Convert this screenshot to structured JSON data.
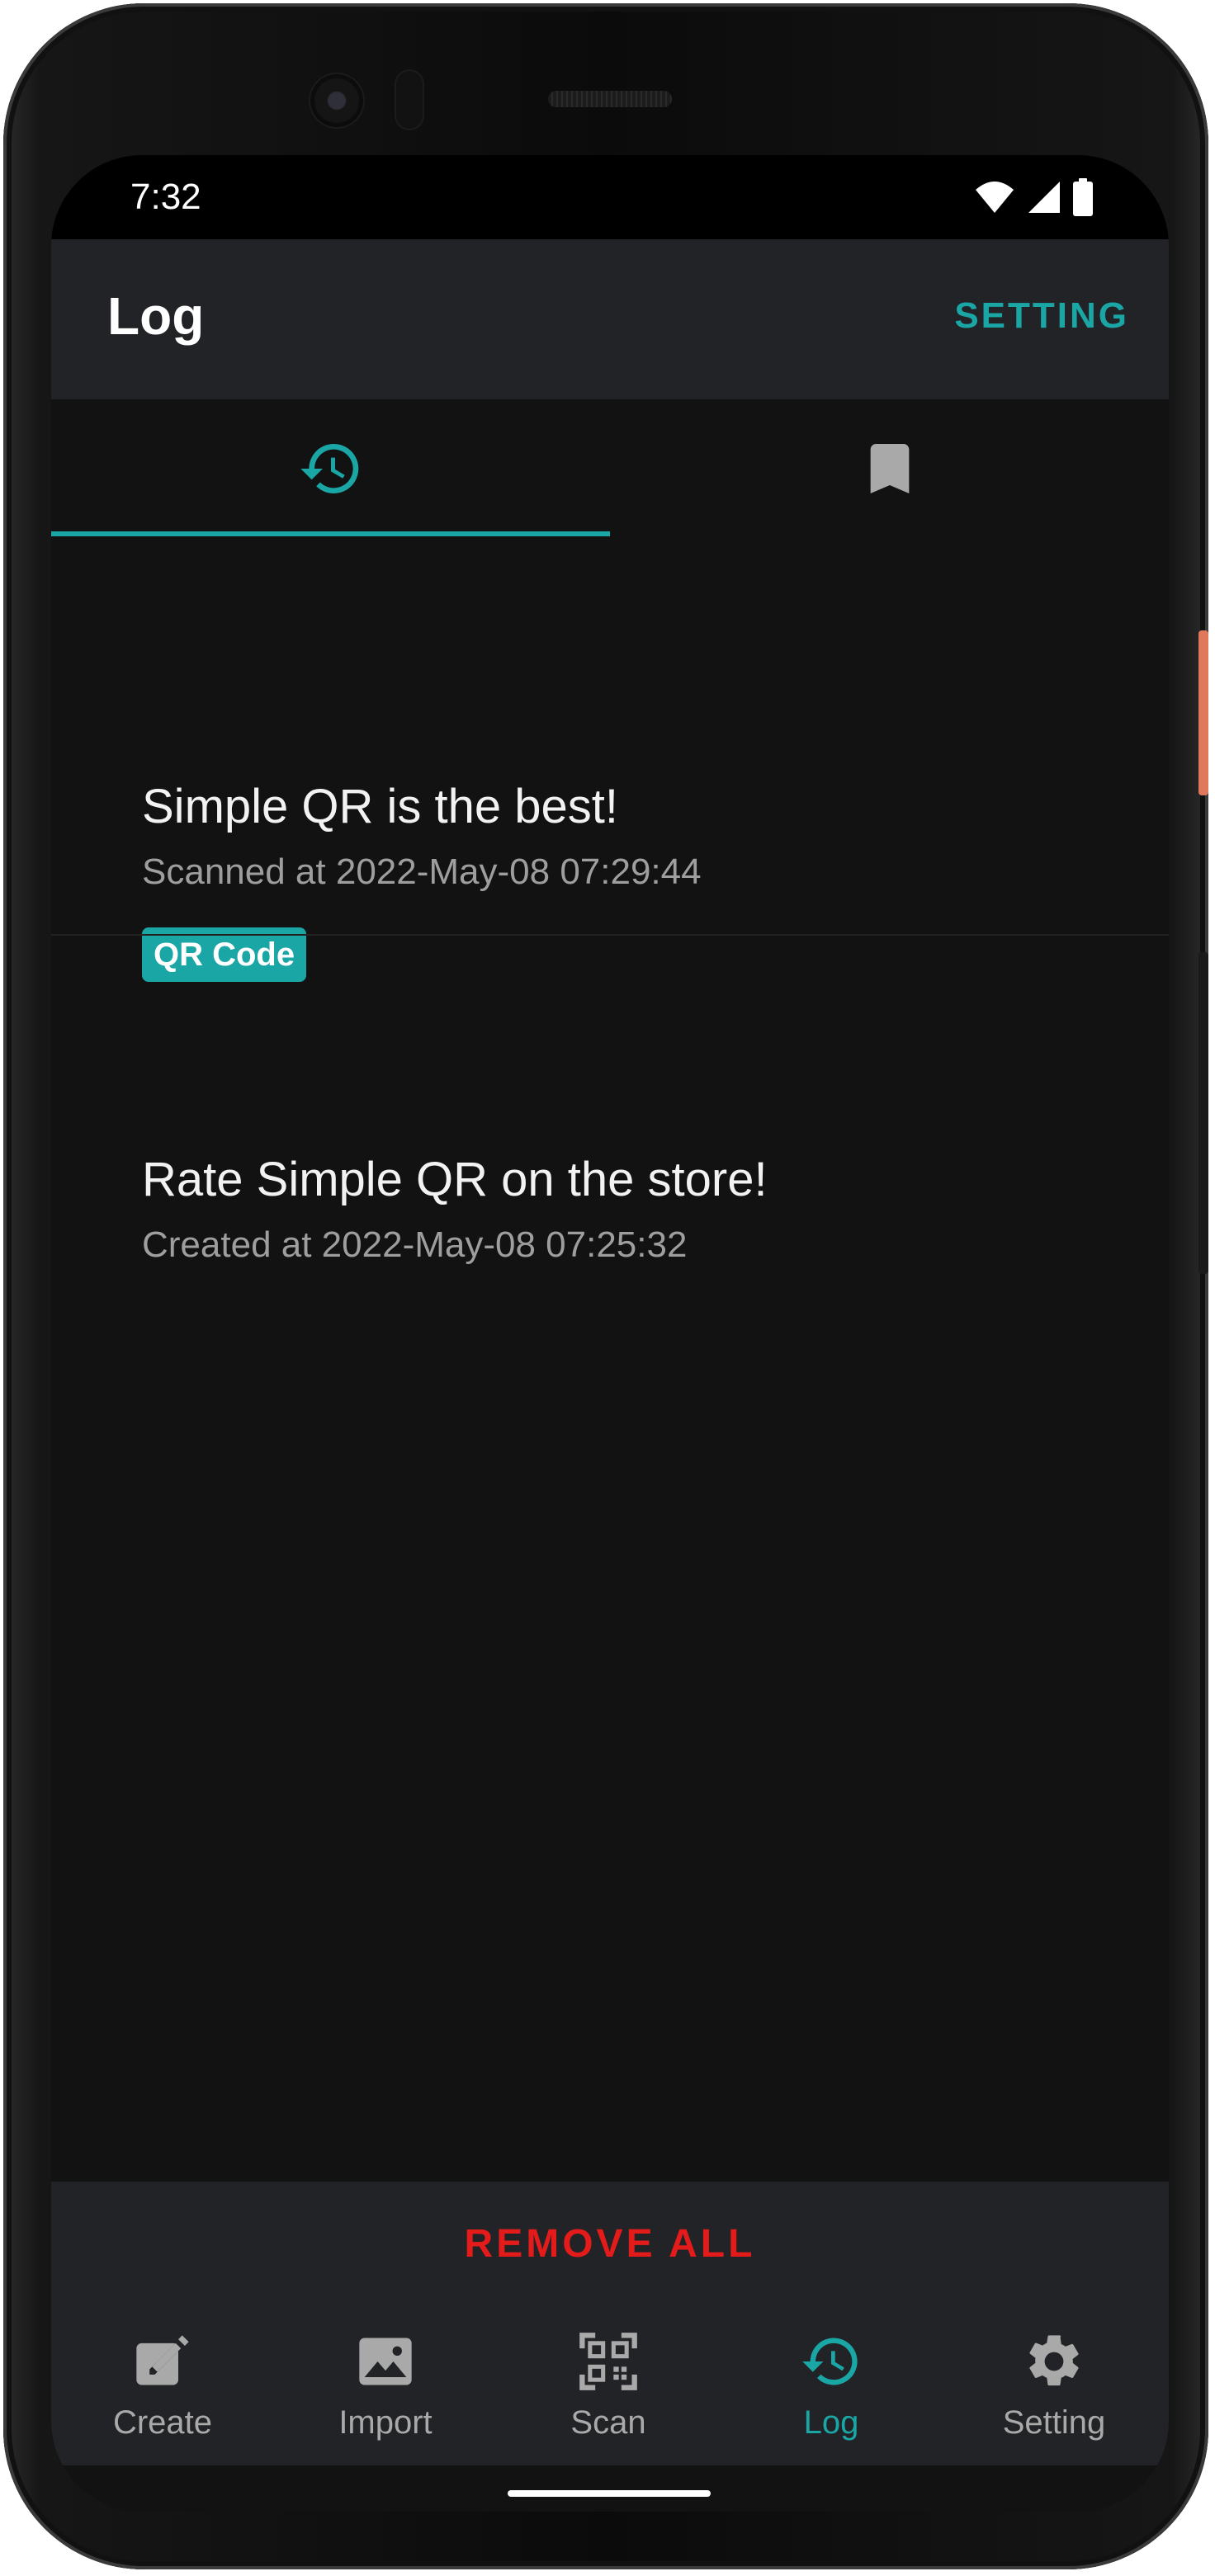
{
  "status_bar": {
    "time": "7:32",
    "icons": [
      "wifi-icon",
      "signal-icon",
      "battery-icon"
    ]
  },
  "app_bar": {
    "title": "Log",
    "action_label": "SETTING"
  },
  "tabs": [
    {
      "icon": "history-icon",
      "selected": true
    },
    {
      "icon": "bookmark-icon",
      "selected": false
    }
  ],
  "log_items": [
    {
      "title": "Simple QR is the best!",
      "subtitle": "Scanned at 2022-May-08 07:29:44",
      "badge": "QR Code"
    },
    {
      "title": "Rate Simple QR on the store!",
      "subtitle": "Created at 2022-May-08 07:25:32"
    }
  ],
  "remove_all_label": "REMOVE ALL",
  "bottom_nav": [
    {
      "label": "Create",
      "icon": "edit-icon",
      "active": false
    },
    {
      "label": "Import",
      "icon": "image-icon",
      "active": false
    },
    {
      "label": "Scan",
      "icon": "qr-scan-icon",
      "active": false
    },
    {
      "label": "Log",
      "icon": "history-icon",
      "active": true
    },
    {
      "label": "Setting",
      "icon": "gear-icon",
      "active": false
    }
  ],
  "colors": {
    "accent": "#1ba6a6",
    "danger": "#e41b1b",
    "background": "#121212",
    "surface": "#222326"
  }
}
